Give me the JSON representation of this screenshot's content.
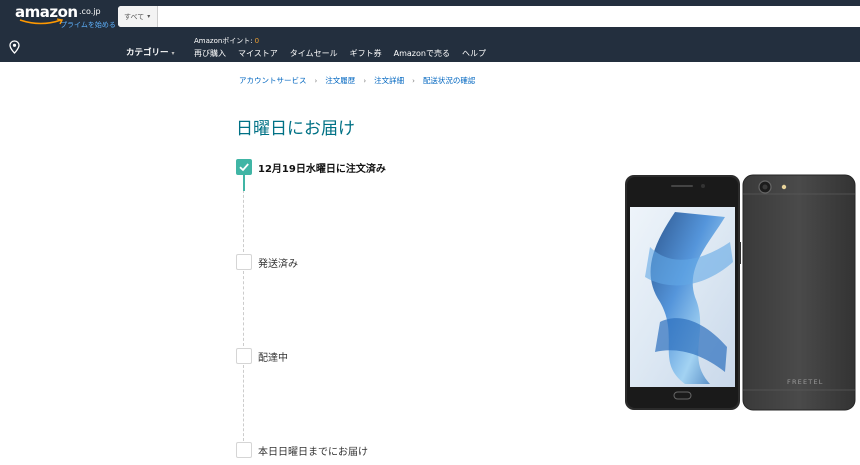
{
  "header": {
    "logo_text": "amazon",
    "logo_tld": ".co.jp",
    "prime_link": "プライムを始める",
    "search_category": "すべて",
    "search_placeholder": "",
    "category_menu": "カテゴリー",
    "points_label": "Amazonポイント:",
    "points_value": "0",
    "nav_links": [
      "再び購入",
      "マイストア",
      "タイムセール",
      "ギフト券",
      "Amazonで売る",
      "ヘルプ"
    ]
  },
  "breadcrumb": [
    "アカウントサービス",
    "注文履歴",
    "注文詳細",
    "配送状況の確認"
  ],
  "heading": "日曜日にお届け",
  "steps": [
    {
      "label": "12月19日水曜日に注文済み",
      "done": true
    },
    {
      "label": "発送済み",
      "done": false
    },
    {
      "label": "配達中",
      "done": false
    },
    {
      "label": "本日日曜日までにお届け",
      "done": false
    }
  ],
  "product": {
    "brand_mark": "FREETEL"
  },
  "colors": {
    "header_bg": "#232f3e",
    "accent_teal": "#40b5a5",
    "heading_teal": "#007185",
    "link_blue": "#0066c0",
    "points_orange": "#f0a030"
  }
}
